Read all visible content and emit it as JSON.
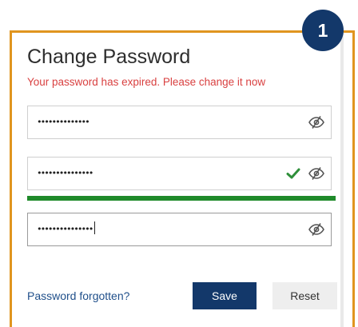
{
  "step_badge": "1",
  "dialog": {
    "title": "Change Password",
    "warning": "Your password has expired. Please change it now"
  },
  "fields": [
    {
      "name": "current-password",
      "value": "••••••••••••••",
      "icon": "eye-slash-icon",
      "valid": false
    },
    {
      "name": "new-password",
      "value": "•••••••••••••••",
      "icon": "eye-slash-icon",
      "valid": true
    },
    {
      "name": "confirm-password",
      "value": "•••••••••••••••",
      "icon": "eye-slash-icon",
      "valid": false,
      "focused": true
    }
  ],
  "strength_meter": {
    "level": 1.0,
    "color": "#1f8a2a"
  },
  "footer": {
    "forgot_link": "Password forgotten?",
    "save_label": "Save",
    "reset_label": "Reset"
  },
  "colors": {
    "accent_border": "#e0951f",
    "primary": "#13386a",
    "warning": "#d94141",
    "link": "#1f4f8a",
    "success": "#1f8a2a"
  }
}
